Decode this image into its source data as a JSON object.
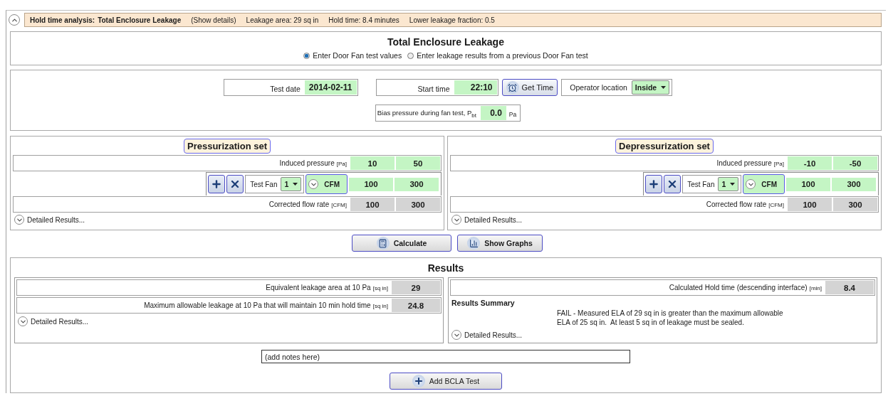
{
  "header": {
    "expanded": true,
    "title": "Hold time analysis:",
    "subject": "Total Enclosure Leakage",
    "details_link": "(Show details)",
    "stats": [
      "Leakage area: 29 sq in",
      "Hold time: 8.4 minutes",
      "Lower leakage fraction: 0.5"
    ]
  },
  "mode": {
    "title": "Total Enclosure Leakage",
    "options": [
      {
        "label": "Enter Door Fan test values",
        "selected": true
      },
      {
        "label": "Enter leakage results from a previous Door Fan test",
        "selected": false
      }
    ]
  },
  "test_info": {
    "test_date": {
      "label": "Test date",
      "value": "2014-02-11"
    },
    "start_time": {
      "label": "Start time",
      "value": "22:10"
    },
    "get_time_button": "Get Time",
    "operator_location": {
      "label": "Operator location",
      "value": "Inside"
    },
    "bias": {
      "label": "Bias pressure during fan test, P$_{bt}$",
      "value": "0.0",
      "unit": "Pa"
    }
  },
  "sets": [
    {
      "title": "Pressurization set",
      "induced": {
        "label": "Induced pressure",
        "unit": "[Pa]",
        "values": [
          "10",
          "50"
        ]
      },
      "fan": {
        "label": "Test Fan",
        "number": "1",
        "unit": "CFM",
        "values": [
          "100",
          "300"
        ]
      },
      "corrected": {
        "label": "Corrected flow rate",
        "unit": "[CFM]",
        "values": [
          "100",
          "300"
        ]
      },
      "details": "Detailed Results..."
    },
    {
      "title": "Depressurization set",
      "induced": {
        "label": "Induced pressure",
        "unit": "[Pa]",
        "values": [
          "-10",
          "-50"
        ]
      },
      "fan": {
        "label": "Test Fan",
        "number": "1",
        "unit": "CFM",
        "values": [
          "100",
          "300"
        ]
      },
      "corrected": {
        "label": "Corrected flow rate",
        "unit": "[CFM]",
        "values": [
          "100",
          "300"
        ]
      },
      "details": "Detailed Results..."
    }
  ],
  "actions": [
    {
      "label": "Calculate",
      "kind": "calculate"
    },
    {
      "label": "Show Graphs",
      "kind": "graphs"
    }
  ],
  "results": {
    "title": "Results",
    "left_rows": [
      {
        "label": "Equivalent leakage area at 10 Pa",
        "unit": "[sq in]",
        "value": "29"
      },
      {
        "label": "Maximum allowable leakage at 10 Pa that will maintain 10 min hold time",
        "unit": "[sq in]",
        "value": "24.8"
      }
    ],
    "left_details": "Detailed Results...",
    "hold_time": {
      "label": "Calculated Hold time (descending interface)",
      "unit": "[min]",
      "value": "8.4"
    },
    "summary_title": "Results Summary",
    "summary_lines": [
      "FAIL - Measured ELA of 29 sq in is greater than the maximum allowable",
      "ELA of 25 sq in.  At least 5 sq in of leakage must be sealed."
    ],
    "right_details": "Detailed Results..."
  },
  "notes": {
    "value": "(add notes here)"
  },
  "add_button": "Add BCLA Test"
}
